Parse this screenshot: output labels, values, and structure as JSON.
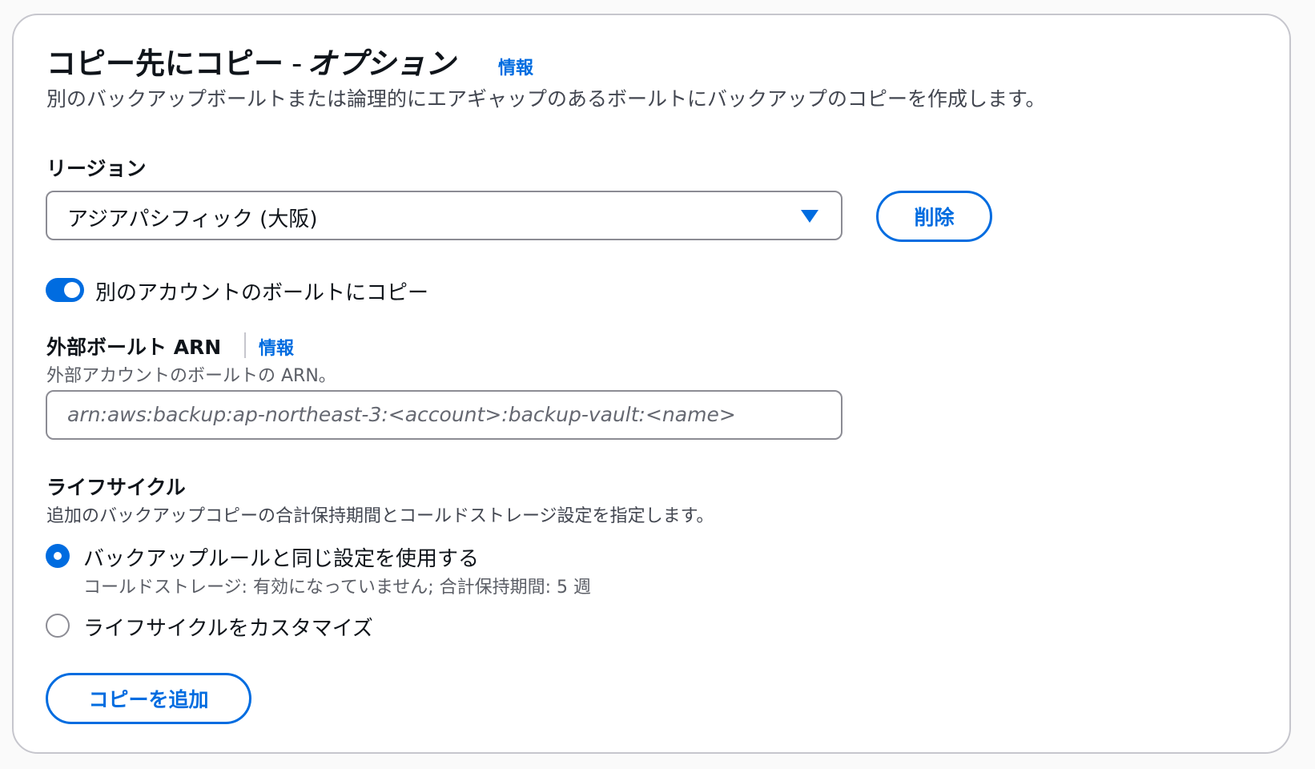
{
  "header": {
    "title_main": "コピー先にコピー",
    "title_sep": "-",
    "title_option": "オプション",
    "info_link": "情報",
    "description": "別のバックアップボールトまたは論理的にエアギャップのあるボールトにバックアップのコピーを作成します。"
  },
  "region": {
    "label": "リージョン",
    "selected_value": "アジアパシフィック (大阪)",
    "delete_button": "削除"
  },
  "cross_account": {
    "toggle_enabled": true,
    "toggle_label": "別のアカウントのボールトにコピー"
  },
  "external_vault_arn": {
    "label": "外部ボールト ARN",
    "info_link": "情報",
    "description": "外部アカウントのボールトの ARN。",
    "value": "",
    "placeholder": "arn:aws:backup:ap-northeast-3:<account>:backup-vault:<name>"
  },
  "lifecycle": {
    "label": "ライフサイクル",
    "description": "追加のバックアップコピーの合計保持期間とコールドストレージ設定を指定します。",
    "options": [
      {
        "label": "バックアップルールと同じ設定を使用する",
        "description": "コールドストレージ: 有効になっていません; 合計保持期間: 5 週",
        "selected": true
      },
      {
        "label": "ライフサイクルをカスタマイズ",
        "selected": false
      }
    ]
  },
  "add_copy_button": "コピーを追加",
  "colors": {
    "accent": "#006ce0",
    "text": "#0f141a",
    "muted_text": "#5b5e66",
    "border": "#8c8c94"
  }
}
